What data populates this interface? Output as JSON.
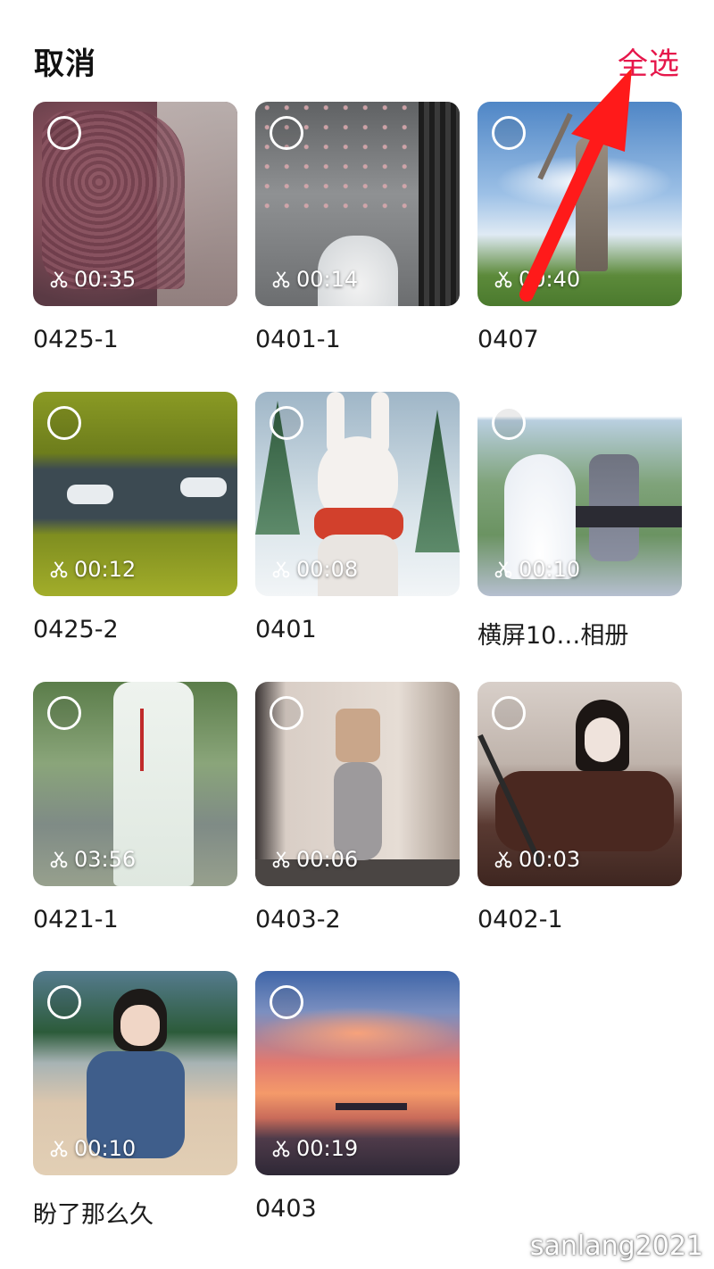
{
  "header": {
    "cancel_label": "取消",
    "select_all_label": "全选"
  },
  "albums": [
    {
      "title": "0425-1",
      "duration": "00:35",
      "icon": "scissors-icon"
    },
    {
      "title": "0401-1",
      "duration": "00:14",
      "icon": "scissors-icon"
    },
    {
      "title": "0407",
      "duration": "00:40",
      "icon": "scissors-icon"
    },
    {
      "title": "0425-2",
      "duration": "00:12",
      "icon": "scissors-icon"
    },
    {
      "title": "0401",
      "duration": "00:08",
      "icon": "scissors-icon"
    },
    {
      "title": "横屏10…相册",
      "duration": "00:10",
      "icon": "scissors-icon"
    },
    {
      "title": "0421-1",
      "duration": "03:56",
      "icon": "scissors-icon"
    },
    {
      "title": "0403-2",
      "duration": "00:06",
      "icon": "scissors-icon"
    },
    {
      "title": "0402-1",
      "duration": "00:03",
      "icon": "scissors-icon"
    },
    {
      "title": "盼了那么久",
      "duration": "00:10",
      "icon": "scissors-icon"
    },
    {
      "title": "0403",
      "duration": "00:19",
      "icon": "scissors-icon"
    }
  ],
  "watermark": "sanlang2021",
  "colors": {
    "accent": "#e6174b",
    "annotation_arrow": "#ff1a1a"
  }
}
